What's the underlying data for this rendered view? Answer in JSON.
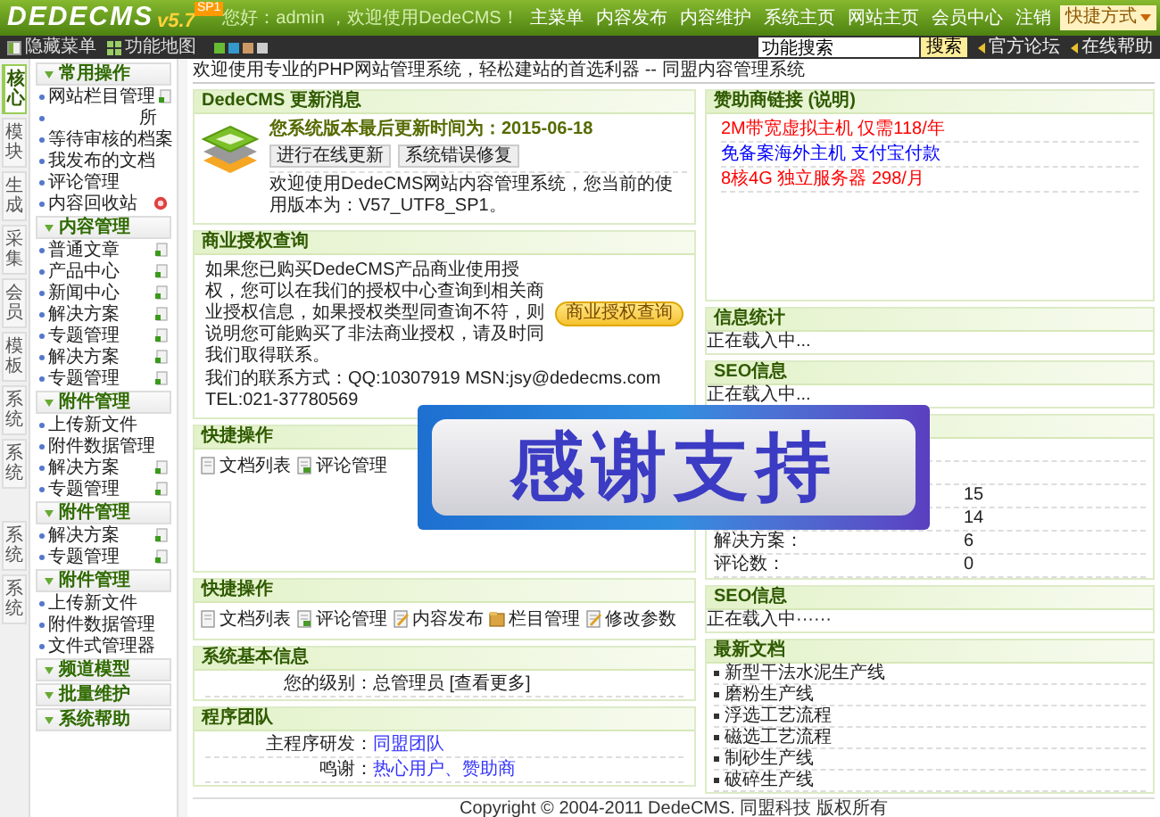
{
  "header": {
    "logo": "DEDECMS",
    "version": "v5.7",
    "badge": "SP1",
    "greeting": "您好：admin ，欢迎使用DedeCMS！",
    "nav": [
      "主菜单",
      "内容发布",
      "内容维护",
      "系统主页",
      "网站主页",
      "会员中心",
      "注销"
    ],
    "shortcut": "快捷方式"
  },
  "toolbar": {
    "tools": [
      {
        "label": "隐藏菜单",
        "kind": "hide"
      },
      {
        "label": "功能地图",
        "kind": "map"
      }
    ],
    "skins": [
      {
        "color": "#66bb33"
      },
      {
        "color": "#3399cc"
      },
      {
        "color": "#cc9966"
      },
      {
        "color": "#cccccc"
      }
    ],
    "search": {
      "value": "功能搜索",
      "button": "搜索"
    },
    "links": [
      "官方论坛",
      "在线帮助"
    ]
  },
  "rail": [
    {
      "label": "核心",
      "selected": true
    },
    {
      "label": "模块",
      "selected": false
    },
    {
      "label": "生成",
      "selected": false
    },
    {
      "label": "采集",
      "selected": false
    },
    {
      "label": "会员",
      "selected": false
    },
    {
      "label": "模板",
      "selected": false
    },
    {
      "label": "系统",
      "selected": false
    },
    {
      "label": "系统",
      "selected": false
    }
  ],
  "rail_lower": [
    {
      "label": "系统",
      "selected": false
    },
    {
      "label": "系统",
      "selected": false
    }
  ],
  "menu": [
    {
      "title": "常用操作",
      "items": [
        {
          "label": "网站栏目管理",
          "kind": "add"
        },
        {
          "label": "所",
          "kind": "aside"
        },
        {
          "label": "等待审核的档案",
          "kind": "plain"
        },
        {
          "label": "我发布的文档",
          "kind": "plain"
        },
        {
          "label": "评论管理",
          "kind": "plain"
        },
        {
          "label": "内容回收站",
          "kind": "trash"
        }
      ]
    },
    {
      "title": "内容管理",
      "items": [
        {
          "label": "普通文章",
          "kind": "add"
        },
        {
          "label": "产品中心",
          "kind": "add"
        },
        {
          "label": "新闻中心",
          "kind": "add"
        },
        {
          "label": "解决方案",
          "kind": "add"
        },
        {
          "label": "专题管理",
          "kind": "add"
        },
        {
          "label": "解决方案",
          "kind": "add"
        },
        {
          "label": "专题管理",
          "kind": "add"
        }
      ]
    },
    {
      "title": "附件管理",
      "items": [
        {
          "label": "上传新文件",
          "kind": "plain"
        },
        {
          "label": "附件数据管理",
          "kind": "plain"
        },
        {
          "label": "解决方案",
          "kind": "add"
        },
        {
          "label": "专题管理",
          "kind": "add"
        }
      ]
    },
    {
      "title": "附件管理",
      "items": [
        {
          "label": "解决方案",
          "kind": "add"
        },
        {
          "label": "专题管理",
          "kind": "add"
        }
      ]
    },
    {
      "title": "附件管理",
      "items": [
        {
          "label": "上传新文件",
          "kind": "plain"
        },
        {
          "label": "附件数据管理",
          "kind": "plain"
        },
        {
          "label": "文件式管理器",
          "kind": "plain"
        }
      ]
    },
    {
      "title": "频道模型"
    },
    {
      "title": "批量维护"
    },
    {
      "title": "系统帮助"
    }
  ],
  "welcome": "欢迎使用专业的PHP网站管理系统，轻松建站的首选利器 -- 同盟内容管理系统",
  "left_panels": [
    {
      "kind": "update",
      "title": "DedeCMS 更新消息",
      "headline": "您系统版本最后更新时间为：2015-06-18",
      "buttons": [
        "进行在线更新",
        "系统错误修复"
      ],
      "text": "欢迎使用DedeCMS网站内容管理系统，您当前的使用版本为：V57_UTF8_SP1。"
    },
    {
      "kind": "license",
      "title": "商业授权查询",
      "text": "如果您已购买DedeCMS产品商业使用授权，您可以在我们的授权中心查询到相关商业授权信息，如果授权类型同查询不符，则说明您可能购买了非法商业授权，请及时同我们取得联系。",
      "contact": "我们的联系方式：QQ:10307919 MSN:jsy@dedecms.com TEL:021-37780569",
      "button": "商业授权查询"
    },
    {
      "kind": "shortcuts",
      "title": "快捷操作",
      "items": [
        {
          "label": "文档列表",
          "kind": "doc"
        },
        {
          "label": "评论管理",
          "kind": "comment"
        }
      ]
    },
    {
      "kind": "shortcuts",
      "title": "快捷操作",
      "items": [
        {
          "label": "文档列表",
          "kind": "doc"
        },
        {
          "label": "评论管理",
          "kind": "comment"
        },
        {
          "label": "内容发布",
          "kind": "edit"
        },
        {
          "label": "栏目管理",
          "kind": "folder"
        },
        {
          "label": "修改参数",
          "kind": "edit"
        }
      ]
    },
    {
      "kind": "info",
      "title": "系统基本信息",
      "rows": [
        {
          "label": "您的级别：",
          "value": "总管理员",
          "link": "[查看更多]"
        }
      ]
    },
    {
      "kind": "team",
      "title": "程序团队",
      "rows": [
        {
          "label": "主程序研发：",
          "value": "同盟团队"
        },
        {
          "label": "鸣谢：",
          "value": "热心用户、赞助商"
        }
      ]
    }
  ],
  "right_panels": [
    {
      "kind": "sponsor",
      "title": "赞助商链接 (说明)",
      "links": [
        {
          "text": "2M带宽虚拟主机 仅需118/年",
          "color": "#ff0000"
        },
        {
          "text": "免备案海外主机 支付宝付款",
          "color": "#0000ff"
        },
        {
          "text": "8核4G 独立服务器 298/月",
          "color": "#ff0000"
        }
      ]
    },
    {
      "kind": "loading",
      "title": "信息统计",
      "text": "正在载入中..."
    },
    {
      "kind": "loading",
      "title": "SEO信息",
      "text": "正在载入中..."
    },
    {
      "kind": "stats",
      "rows": [
        {
          "value": "15"
        },
        {
          "value": "14"
        },
        {
          "label": "解决方案：",
          "value": "6"
        },
        {
          "label": "评论数：",
          "value": "0"
        }
      ],
      "overlay": {
        "text": "感谢支持"
      }
    },
    {
      "kind": "loading",
      "title": "SEO信息",
      "text": "正在载入中······"
    },
    {
      "kind": "docs",
      "title": "最新文档",
      "items": [
        "新型干法水泥生产线",
        "磨粉生产线",
        "浮选工艺流程",
        "磁选工艺流程",
        "制砂生产线",
        "破碎生产线"
      ]
    }
  ],
  "footer": "Copyright © 2004-2011 DedeCMS. 同盟科技 版权所有"
}
